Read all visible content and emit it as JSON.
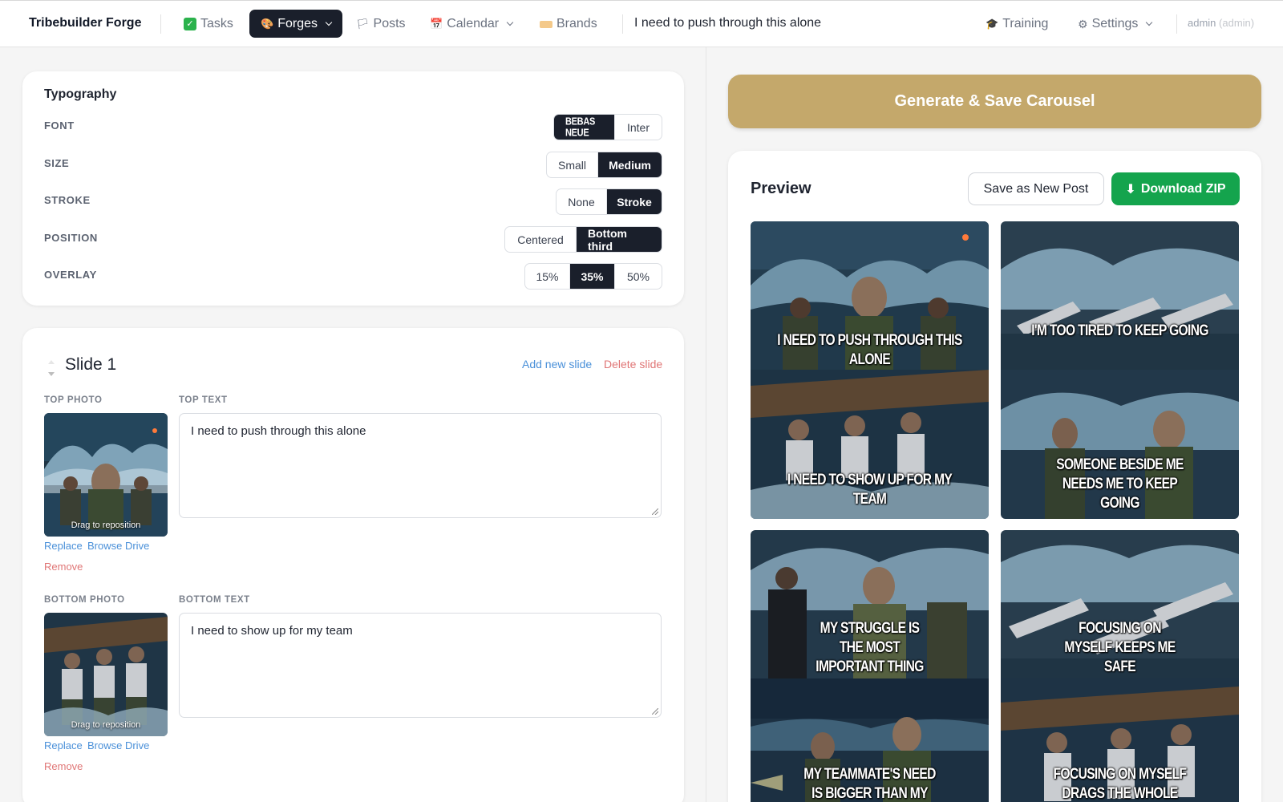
{
  "nav": {
    "brand": "Tribebuilder Forge",
    "items": [
      {
        "label": "Tasks",
        "icon": "check-box-icon"
      },
      {
        "label": "Forges",
        "icon": "palette-icon",
        "active": true
      },
      {
        "label": "Posts",
        "icon": "flag-icon"
      },
      {
        "label": "Calendar",
        "icon": "calendar-icon"
      },
      {
        "label": "Brands",
        "icon": "tag-icon"
      }
    ],
    "page_heading": "I need to push through this alone",
    "training": "Training",
    "settings": "Settings",
    "user": "admin",
    "role": "(admin)"
  },
  "typography": {
    "title": "Typography",
    "font": {
      "label": "FONT",
      "options": [
        "BEBAS NEUE",
        "Inter"
      ],
      "selected": "BEBAS NEUE"
    },
    "size": {
      "label": "SIZE",
      "options": [
        "Small",
        "Medium"
      ],
      "selected": "Medium"
    },
    "stroke": {
      "label": "STROKE",
      "options": [
        "None",
        "Stroke"
      ],
      "selected": "Stroke"
    },
    "position": {
      "label": "POSITION",
      "options": [
        "Centered",
        "Bottom third"
      ],
      "selected": "Bottom third"
    },
    "overlay": {
      "label": "OVERLAY",
      "options": [
        "15%",
        "35%",
        "50%"
      ],
      "selected": "35%"
    }
  },
  "slide": {
    "title": "Slide 1",
    "add": "Add new slide",
    "delete": "Delete slide",
    "top_photo_label": "TOP PHOTO",
    "top_text_label": "TOP TEXT",
    "top_text": "I need to push through this alone",
    "bottom_photo_label": "BOTTOM PHOTO",
    "bottom_text_label": "BOTTOM TEXT",
    "bottom_text": "I need to show up for my team",
    "drag_hint": "Drag to reposition",
    "replace": "Replace",
    "browse": "Browse Drive",
    "remove": "Remove"
  },
  "generate": "Generate & Save Carousel",
  "preview": {
    "title": "Preview",
    "save_new": "Save as New Post",
    "download": "Download ZIP",
    "tiles": [
      {
        "top": "I need to push through this alone",
        "bottom": "I need to show up for my team"
      },
      {
        "top": "I'm too tired to keep going",
        "bottom": "Someone beside me needs me to keep going"
      },
      {
        "top": "My struggle is the most important thing",
        "bottom": "My teammate's need is bigger than my comfort"
      },
      {
        "top": "Focusing on myself keeps me safe",
        "bottom": "Focusing on myself drags the whole team down"
      }
    ]
  },
  "colors": {
    "accent_gold": "#c4a86b",
    "download_green": "#14a44d",
    "active_dark": "#1a1f2b",
    "link_blue": "#4a90d9",
    "danger_red": "#e07676"
  }
}
